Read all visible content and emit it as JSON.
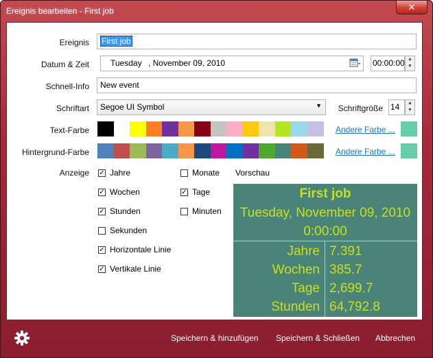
{
  "window": {
    "title": "Ereignis bearbeiten - First job",
    "close_glyph": "✕"
  },
  "form": {
    "event_label": "Ereignis",
    "event_value": "First job",
    "datetime_label": "Datum & Zeit",
    "date_weekday": "Tuesday",
    "date_rest": ", November 09, 2010",
    "time_value": "00:00:00",
    "info_label": "Schnell-Info",
    "info_value": "New event",
    "font_label": "Schriftart",
    "font_value": "Segoe UI Symbol",
    "fontsize_label": "Schriftgröße",
    "fontsize_value": "14",
    "textcolor_label": "Text-Farbe",
    "bgcolor_label": "Hintergrund-Farbe",
    "other_color": "Andere Farbe ...",
    "display_label": "Anzeige",
    "preview_label": "Vorschau"
  },
  "text_colors": [
    "#000000",
    "#ffffff",
    "#ffff00",
    "#ff7f27",
    "#7030a0",
    "#f79646",
    "#880015",
    "#c3c3c3",
    "#ffaec9",
    "#ffc90e",
    "#efe4b0",
    "#b5e61d",
    "#99d9ea",
    "#c8bfe7"
  ],
  "text_color_selected": "#66cdaa",
  "bg_colors": [
    "#4f81bd",
    "#c0504d",
    "#9bbb59",
    "#8064a2",
    "#4bacc6",
    "#f79646",
    "#1f497d",
    "#c0179e",
    "#0070c0",
    "#7030a0",
    "#4ea72e",
    "#4a8378",
    "#d3591b",
    "#6b6b3a"
  ],
  "bg_color_selected": "#66cdaa",
  "checks": [
    {
      "label": "Jahre",
      "checked": true
    },
    {
      "label": "Monate",
      "checked": false
    },
    {
      "label": "Wochen",
      "checked": true
    },
    {
      "label": "Tage",
      "checked": true
    },
    {
      "label": "Stunden",
      "checked": true
    },
    {
      "label": "Minuten",
      "checked": false
    },
    {
      "label": "Sekunden",
      "checked": false
    },
    {
      "label": "Horizontale Linie",
      "checked": true
    },
    {
      "label": "Vertikale Linie",
      "checked": true
    }
  ],
  "preview": {
    "title": "First job",
    "date": "Tuesday, November 09, 2010",
    "time": "0:00:00",
    "rows": [
      {
        "name": "Jahre",
        "value": "7.391"
      },
      {
        "name": "Wochen",
        "value": "385.7"
      },
      {
        "name": "Tage",
        "value": "2,699.7"
      },
      {
        "name": "Stunden",
        "value": "64,792.8"
      }
    ],
    "bg_color": "#4a8378",
    "text_color": "#c8e020"
  },
  "footer": {
    "save_add": "Speichern & hinzufügen",
    "save_close": "Speichern & Schließen",
    "cancel": "Abbrechen"
  }
}
